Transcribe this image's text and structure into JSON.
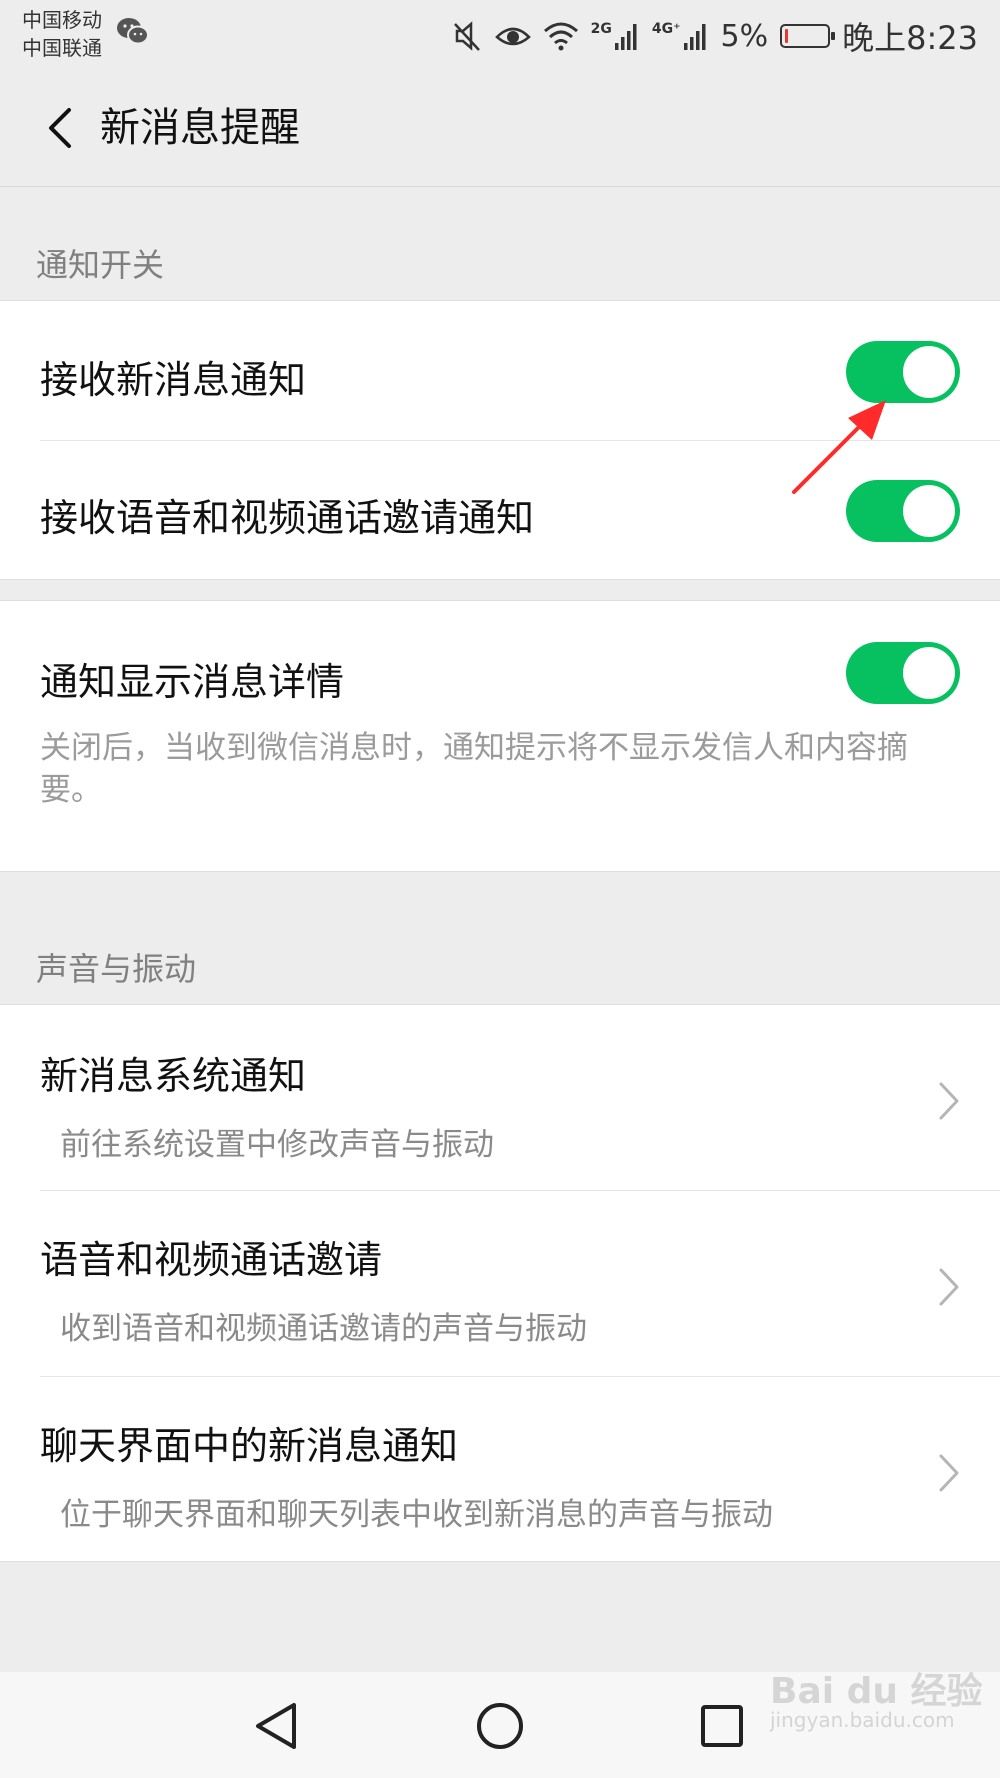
{
  "status_bar": {
    "carrier_1": "中国移动",
    "carrier_2": "中国联通",
    "network_1": "2G",
    "network_2": "4G⁺",
    "battery": "5%",
    "battery_level": 0.05,
    "time": "晚上8:23"
  },
  "header": {
    "title": "新消息提醒"
  },
  "sections": {
    "notify_switch": {
      "title": "通知开关",
      "items": [
        {
          "label": "接收新消息通知",
          "on": true
        },
        {
          "label": "接收语音和视频通话邀请通知",
          "on": true
        }
      ]
    },
    "details": {
      "label": "通知显示消息详情",
      "on": true,
      "desc": "关闭后，当收到微信消息时，通知提示将不显示发信人和内容摘要。"
    },
    "sound_vibration": {
      "title": "声音与振动",
      "items": [
        {
          "label": "新消息系统通知",
          "sub": "前往系统设置中修改声音与振动"
        },
        {
          "label": "语音和视频通话邀请",
          "sub": "收到语音和视频通话邀请的声音与振动"
        },
        {
          "label": "聊天界面中的新消息通知",
          "sub": "位于聊天界面和聊天列表中收到新消息的声音与振动"
        }
      ]
    }
  },
  "watermark": {
    "brand": "Bai du 经验",
    "url": "jingyan.baidu.com"
  },
  "colors": {
    "accent": "#07c160",
    "annotation": "#ff2a2a",
    "background": "#ededed"
  }
}
